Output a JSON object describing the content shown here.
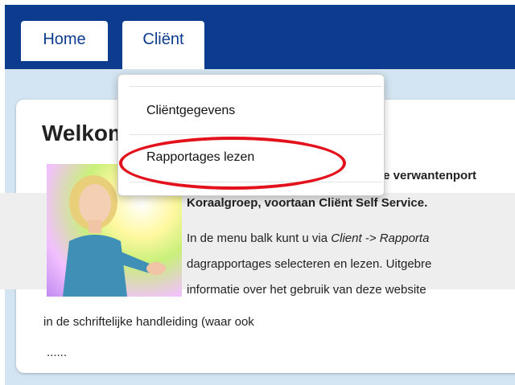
{
  "nav": {
    "home": "Home",
    "client": "Cliënt"
  },
  "dropdown": {
    "item1": "Cliëntgegevens",
    "item2": "Rapportages lezen"
  },
  "welcome": {
    "title": "Welkom"
  },
  "content": {
    "line1": "le verwantenport",
    "line2": "Koraalgroep, voortaan Cliënt Self Service.",
    "line3_a": "In de menu balk kunt u via ",
    "line3_b": "Client -> Rapporta",
    "line4": "dagrapportages selecteren en lezen. Uitgebre",
    "line5": "informatie over het gebruik van deze website",
    "line6": "in de schriftelijke handleiding (waar ook",
    "line7": "......"
  },
  "colors": {
    "nav": "#0d3c8e",
    "background": "#d3e5f2",
    "annotation": "#e2111b"
  }
}
